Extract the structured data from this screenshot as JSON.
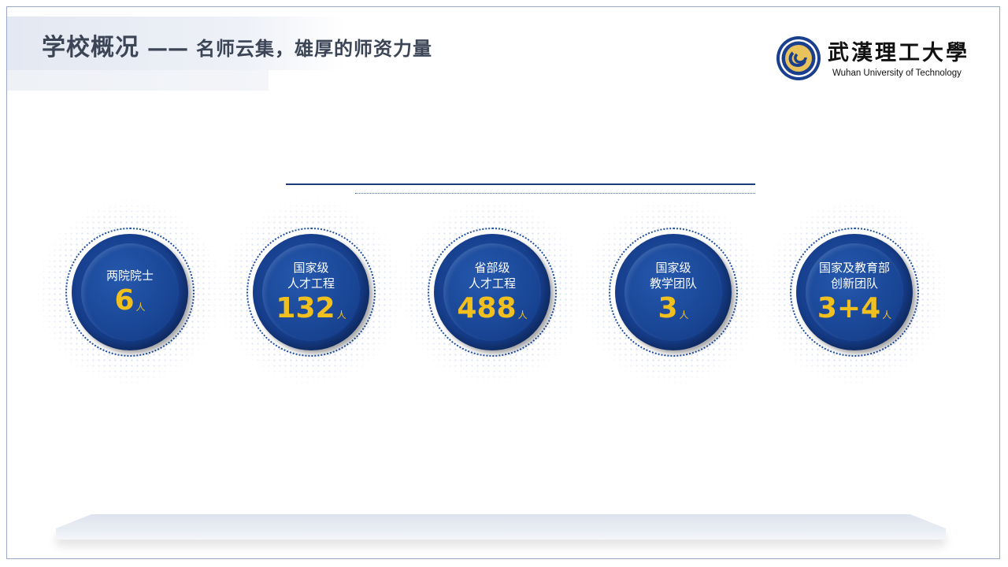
{
  "header": {
    "title_main": "学校概况",
    "title_dash": "——",
    "title_sub": "名师云集，雄厚的师资力量"
  },
  "logo": {
    "cn": "武漢理工大學",
    "en": "Wuhan University of Technology"
  },
  "stats": [
    {
      "label_lines": [
        "两院院士"
      ],
      "value": "6",
      "unit": "人"
    },
    {
      "label_lines": [
        "国家级",
        "人才工程"
      ],
      "value": "132",
      "unit": "人"
    },
    {
      "label_lines": [
        "省部级",
        "人才工程"
      ],
      "value": "488",
      "unit": "人"
    },
    {
      "label_lines": [
        "国家级",
        "教学团队"
      ],
      "value": "3",
      "unit": "人"
    },
    {
      "label_lines": [
        "国家及教育部",
        "创新团队"
      ],
      "value": "3+4",
      "unit": "人"
    }
  ],
  "colors": {
    "accent_blue": "#1a4696",
    "value_gold": "#f2c01e",
    "title_text": "#3b4556"
  }
}
